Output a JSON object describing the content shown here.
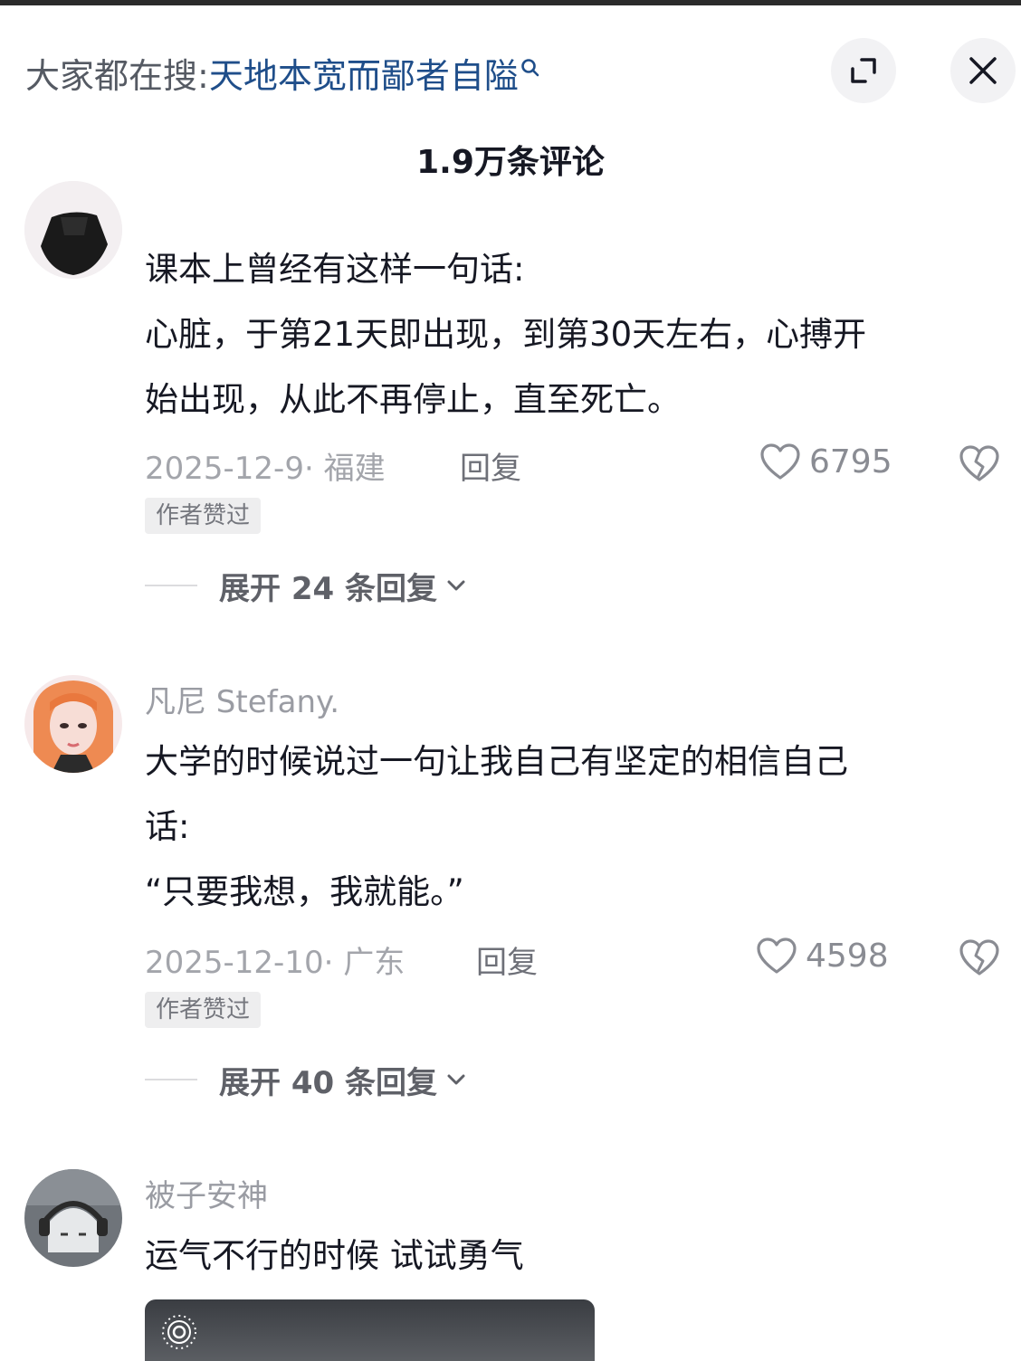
{
  "header": {
    "search_prefix": "大家都在搜:",
    "search_term": "天地本宽而鄙者自隘",
    "expand_icon": "expand-icon",
    "close_icon": "close-icon"
  },
  "comment_count": "1.9万条评论",
  "comments": [
    {
      "text_lines": [
        "课本上曾经有这样一句话:",
        "心脏，于第21天即出现，到第30天左右，心搏开",
        "始出现，从此不再停止，直至死亡。"
      ],
      "meta": "2025-12-9· 福建",
      "reply_label": "回复",
      "likes": "6795",
      "badge": "作者赞过",
      "expand_label": "展开 24 条回复"
    },
    {
      "username": "凡尼 Stefany.",
      "text_lines": [
        "大学的时候说过一句让我自己有坚定的相信自己",
        "话:",
        "“只要我想，我就能。”"
      ],
      "meta": "2025-12-10· 广东",
      "reply_label": "回复",
      "likes": "4598",
      "badge": "作者赞过",
      "expand_label": "展开 40 条回复"
    },
    {
      "username": "被子安神",
      "text_lines": [
        "运气不行的时候 试试勇气"
      ]
    }
  ],
  "colors": {
    "search_term": "#1f4e8a",
    "muted_text": "#a3a5ab",
    "primary_text": "#161823"
  }
}
